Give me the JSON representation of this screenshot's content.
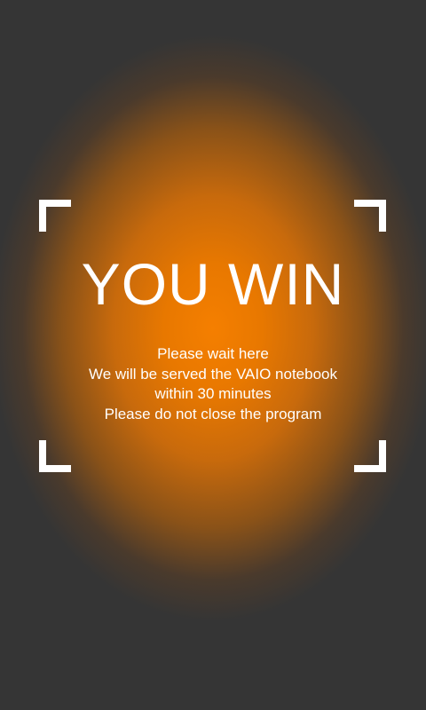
{
  "screen": {
    "title": "YOU WIN",
    "message_lines": [
      "Please wait here",
      "We will be served the VAIO notebook",
      "within 30 minutes",
      "Please do not close the program"
    ]
  },
  "colors": {
    "background": "#353535",
    "glow": "#f57f00",
    "text": "#ffffff"
  }
}
